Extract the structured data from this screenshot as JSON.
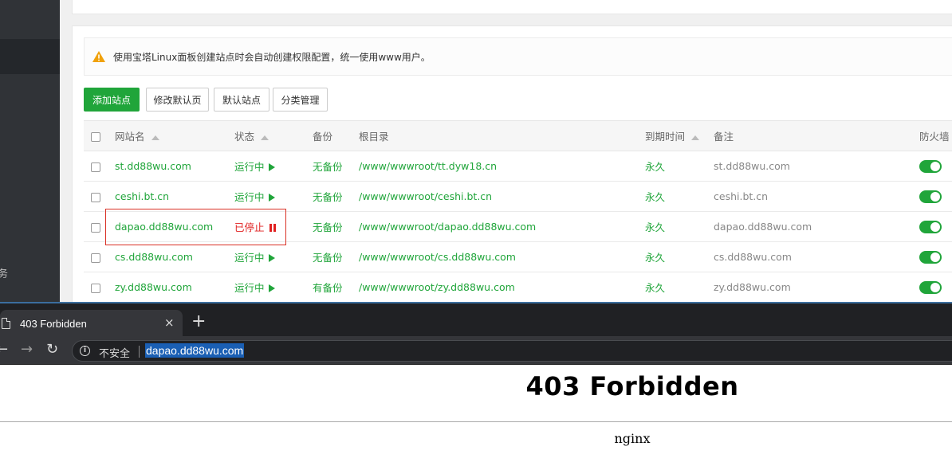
{
  "panel": {
    "sidebar_partial_text": "务",
    "notice": "使用宝塔Linux面板创建站点时会自动创建权限配置，统一使用www用户。",
    "buttons": {
      "add_site": "添加站点",
      "modify_default_page": "修改默认页",
      "default_site": "默认站点",
      "category_manage": "分类管理"
    },
    "table": {
      "headers": [
        "网站名",
        "状态",
        "备份",
        "根目录",
        "到期时间",
        "备注",
        "防火墙"
      ],
      "rows": [
        {
          "name": "st.dd88wu.com",
          "status": "运行中",
          "backup": "无备份",
          "root": "/www/wwwroot/tt.dyw18.cn",
          "expire": "永久",
          "note": "st.dd88wu.com",
          "running": true
        },
        {
          "name": "ceshi.bt.cn",
          "status": "运行中",
          "backup": "无备份",
          "root": "/www/wwwroot/ceshi.bt.cn",
          "expire": "永久",
          "note": "ceshi.bt.cn",
          "running": true
        },
        {
          "name": "dapao.dd88wu.com",
          "status": "已停止",
          "backup": "无备份",
          "root": "/www/wwwroot/dapao.dd88wu.com",
          "expire": "永久",
          "note": "dapao.dd88wu.com",
          "running": false
        },
        {
          "name": "cs.dd88wu.com",
          "status": "运行中",
          "backup": "无备份",
          "root": "/www/wwwroot/cs.dd88wu.com",
          "expire": "永久",
          "note": "cs.dd88wu.com",
          "running": true
        },
        {
          "name": "zy.dd88wu.com",
          "status": "运行中",
          "backup": "有备份",
          "root": "/www/wwwroot/zy.dd88wu.com",
          "expire": "永久",
          "note": "zy.dd88wu.com",
          "running": true
        }
      ]
    }
  },
  "browser": {
    "tab_title": "403 Forbidden",
    "tab_close": "×",
    "new_tab": "+",
    "nav": {
      "back": "←",
      "forward": "→",
      "reload": "↻"
    },
    "security_label": "不安全",
    "url": "dapao.dd88wu.com",
    "page_heading": "403 Forbidden",
    "page_server": "nginx"
  },
  "colors": {
    "accent_green": "#20a53a",
    "stopped_red": "#e02020",
    "sidebar_dark": "#303337",
    "browser_dark": "#202124"
  },
  "icons": [
    "warning-icon",
    "sort-up-icon",
    "play-icon",
    "pause-icon",
    "toggle-on",
    "page-icon",
    "close-icon",
    "plus-icon",
    "back-icon",
    "forward-icon",
    "reload-icon",
    "info-icon"
  ]
}
